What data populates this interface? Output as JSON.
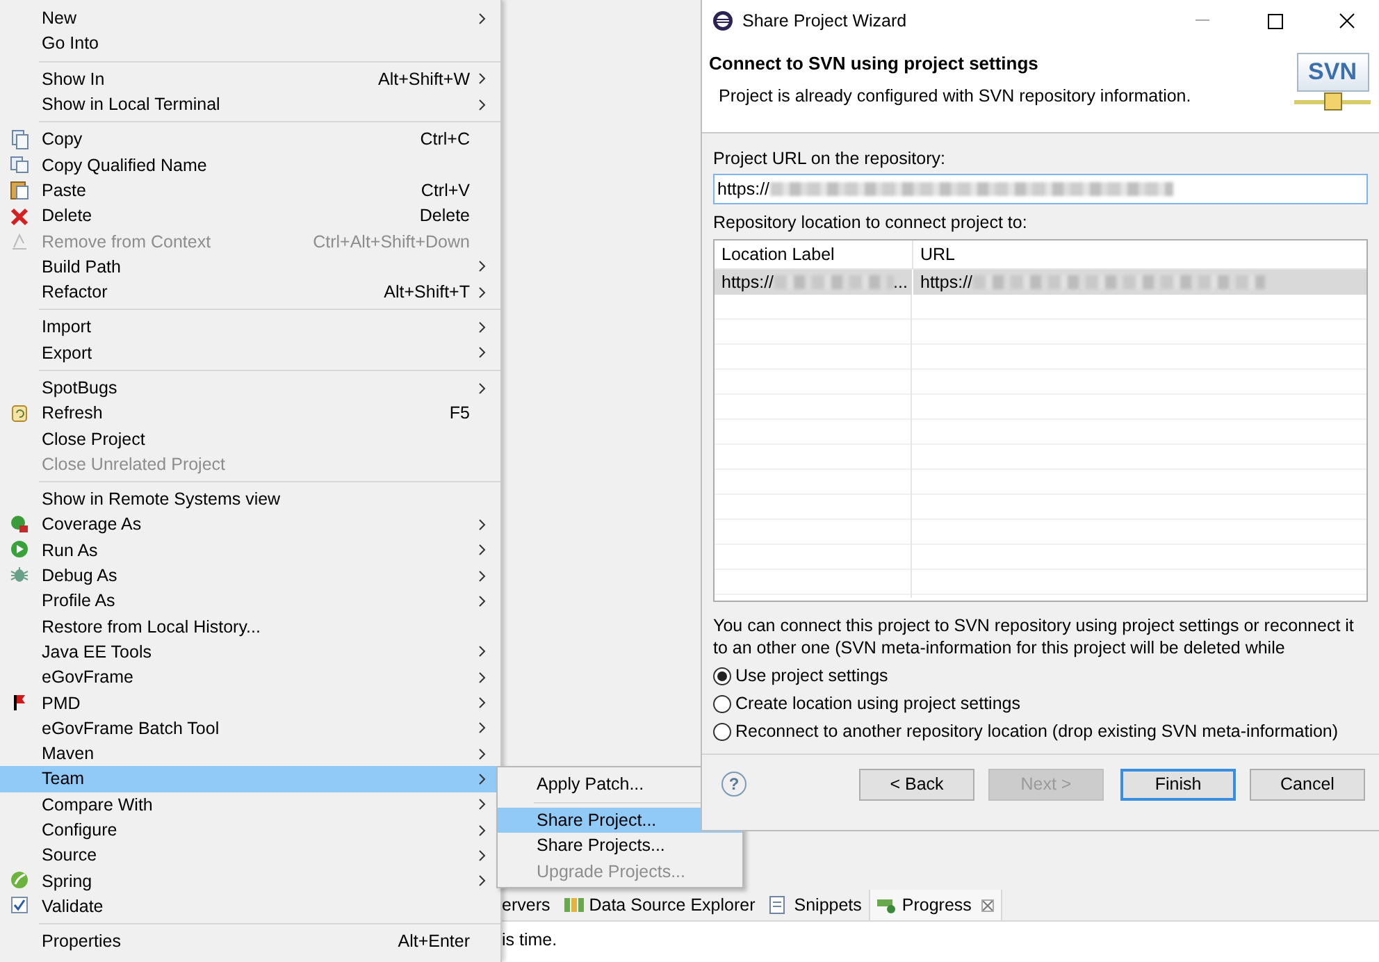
{
  "context_menu": {
    "groups": [
      [
        {
          "label": "New",
          "submenu": true,
          "disabled": false,
          "selected": false
        },
        {
          "label": "Go Into",
          "submenu": false,
          "disabled": false,
          "selected": false
        }
      ],
      [
        {
          "label": "Show In",
          "shortcut": "Alt+Shift+W",
          "submenu": true,
          "disabled": false,
          "selected": false
        },
        {
          "label": "Show in Local Terminal",
          "submenu": true,
          "disabled": false,
          "selected": false
        }
      ],
      [
        {
          "label": "Copy",
          "shortcut": "Ctrl+C",
          "submenu": false,
          "disabled": false,
          "selected": false
        },
        {
          "label": "Copy Qualified Name",
          "submenu": false,
          "disabled": false,
          "selected": false
        },
        {
          "label": "Paste",
          "shortcut": "Ctrl+V",
          "submenu": false,
          "disabled": false,
          "selected": false
        },
        {
          "label": "Delete",
          "shortcut": "Delete",
          "submenu": false,
          "disabled": false,
          "selected": false
        },
        {
          "label": "Remove from Context",
          "shortcut": "Ctrl+Alt+Shift+Down",
          "submenu": false,
          "disabled": true,
          "selected": false
        },
        {
          "label": "Build Path",
          "submenu": true,
          "disabled": false,
          "selected": false
        },
        {
          "label": "Refactor",
          "shortcut": "Alt+Shift+T",
          "submenu": true,
          "disabled": false,
          "selected": false
        }
      ],
      [
        {
          "label": "Import",
          "submenu": true,
          "disabled": false,
          "selected": false
        },
        {
          "label": "Export",
          "submenu": true,
          "disabled": false,
          "selected": false
        }
      ],
      [
        {
          "label": "SpotBugs",
          "submenu": true,
          "disabled": false,
          "selected": false
        },
        {
          "label": "Refresh",
          "shortcut": "F5",
          "submenu": false,
          "disabled": false,
          "selected": false
        },
        {
          "label": "Close Project",
          "submenu": false,
          "disabled": false,
          "selected": false
        },
        {
          "label": "Close Unrelated Project",
          "submenu": false,
          "disabled": true,
          "selected": false
        }
      ],
      [
        {
          "label": "Show in Remote Systems view",
          "submenu": false,
          "disabled": false,
          "selected": false
        },
        {
          "label": "Coverage As",
          "submenu": true,
          "disabled": false,
          "selected": false
        },
        {
          "label": "Run As",
          "submenu": true,
          "disabled": false,
          "selected": false
        },
        {
          "label": "Debug As",
          "submenu": true,
          "disabled": false,
          "selected": false
        },
        {
          "label": "Profile As",
          "submenu": true,
          "disabled": false,
          "selected": false
        },
        {
          "label": "Restore from Local History...",
          "submenu": false,
          "disabled": false,
          "selected": false
        },
        {
          "label": "Java EE Tools",
          "submenu": true,
          "disabled": false,
          "selected": false
        },
        {
          "label": "eGovFrame",
          "submenu": true,
          "disabled": false,
          "selected": false
        },
        {
          "label": "PMD",
          "submenu": true,
          "disabled": false,
          "selected": false
        },
        {
          "label": "eGovFrame Batch Tool",
          "submenu": true,
          "disabled": false,
          "selected": false
        },
        {
          "label": "Maven",
          "submenu": true,
          "disabled": false,
          "selected": false
        },
        {
          "label": "Team",
          "submenu": true,
          "disabled": false,
          "selected": true
        },
        {
          "label": "Compare With",
          "submenu": true,
          "disabled": false,
          "selected": false
        },
        {
          "label": "Configure",
          "submenu": true,
          "disabled": false,
          "selected": false
        },
        {
          "label": "Source",
          "submenu": true,
          "disabled": false,
          "selected": false
        },
        {
          "label": "Spring",
          "submenu": true,
          "disabled": false,
          "selected": false
        },
        {
          "label": "Validate",
          "submenu": false,
          "disabled": false,
          "selected": false
        }
      ],
      [
        {
          "label": "Properties",
          "shortcut": "Alt+Enter",
          "submenu": false,
          "disabled": false,
          "selected": false
        }
      ]
    ]
  },
  "team_submenu": {
    "groups": [
      [
        {
          "label": "Apply Patch...",
          "disabled": false,
          "selected": false
        }
      ],
      [
        {
          "label": "Share Project...",
          "disabled": false,
          "selected": true
        },
        {
          "label": "Share Projects...",
          "disabled": false,
          "selected": false
        },
        {
          "label": "Upgrade Projects...",
          "disabled": true,
          "selected": false
        }
      ]
    ]
  },
  "dialog": {
    "title": "Share Project Wizard",
    "heading": "Connect to SVN using project settings",
    "description": "Project is already configured with SVN repository information.",
    "logo": "SVN",
    "project_url": {
      "label": "Project URL on the repository:",
      "value": "https://"
    },
    "repository_label": "Repository location to connect project to:",
    "table": {
      "columns": [
        "Location Label",
        "URL"
      ],
      "rows": [
        {
          "location_label": "https://",
          "location_label_end": "...",
          "url": "https://",
          "selected": true
        }
      ]
    },
    "info": "You can connect this project to SVN repository using project settings or reconnect it to an other one (SVN meta-information for this project will be deleted while",
    "options": [
      {
        "label": "Use project settings",
        "selected": true
      },
      {
        "label": "Create location using project settings",
        "selected": false
      },
      {
        "label": "Reconnect to another repository location (drop existing SVN meta-information)",
        "selected": false
      }
    ],
    "help": "?",
    "buttons": [
      {
        "label": "< Back",
        "disabled": false,
        "default": false
      },
      {
        "label": "Next >",
        "disabled": true,
        "default": false
      },
      {
        "label": "Finish",
        "disabled": false,
        "default": true
      },
      {
        "label": "Cancel",
        "disabled": false,
        "default": false
      }
    ]
  },
  "views": {
    "tabs": [
      {
        "label": "ervers",
        "selected": false
      },
      {
        "label": "Data Source Explorer",
        "selected": false
      },
      {
        "label": "Snippets",
        "selected": false
      },
      {
        "label": "Progress",
        "selected": true
      }
    ],
    "content": "is time."
  }
}
